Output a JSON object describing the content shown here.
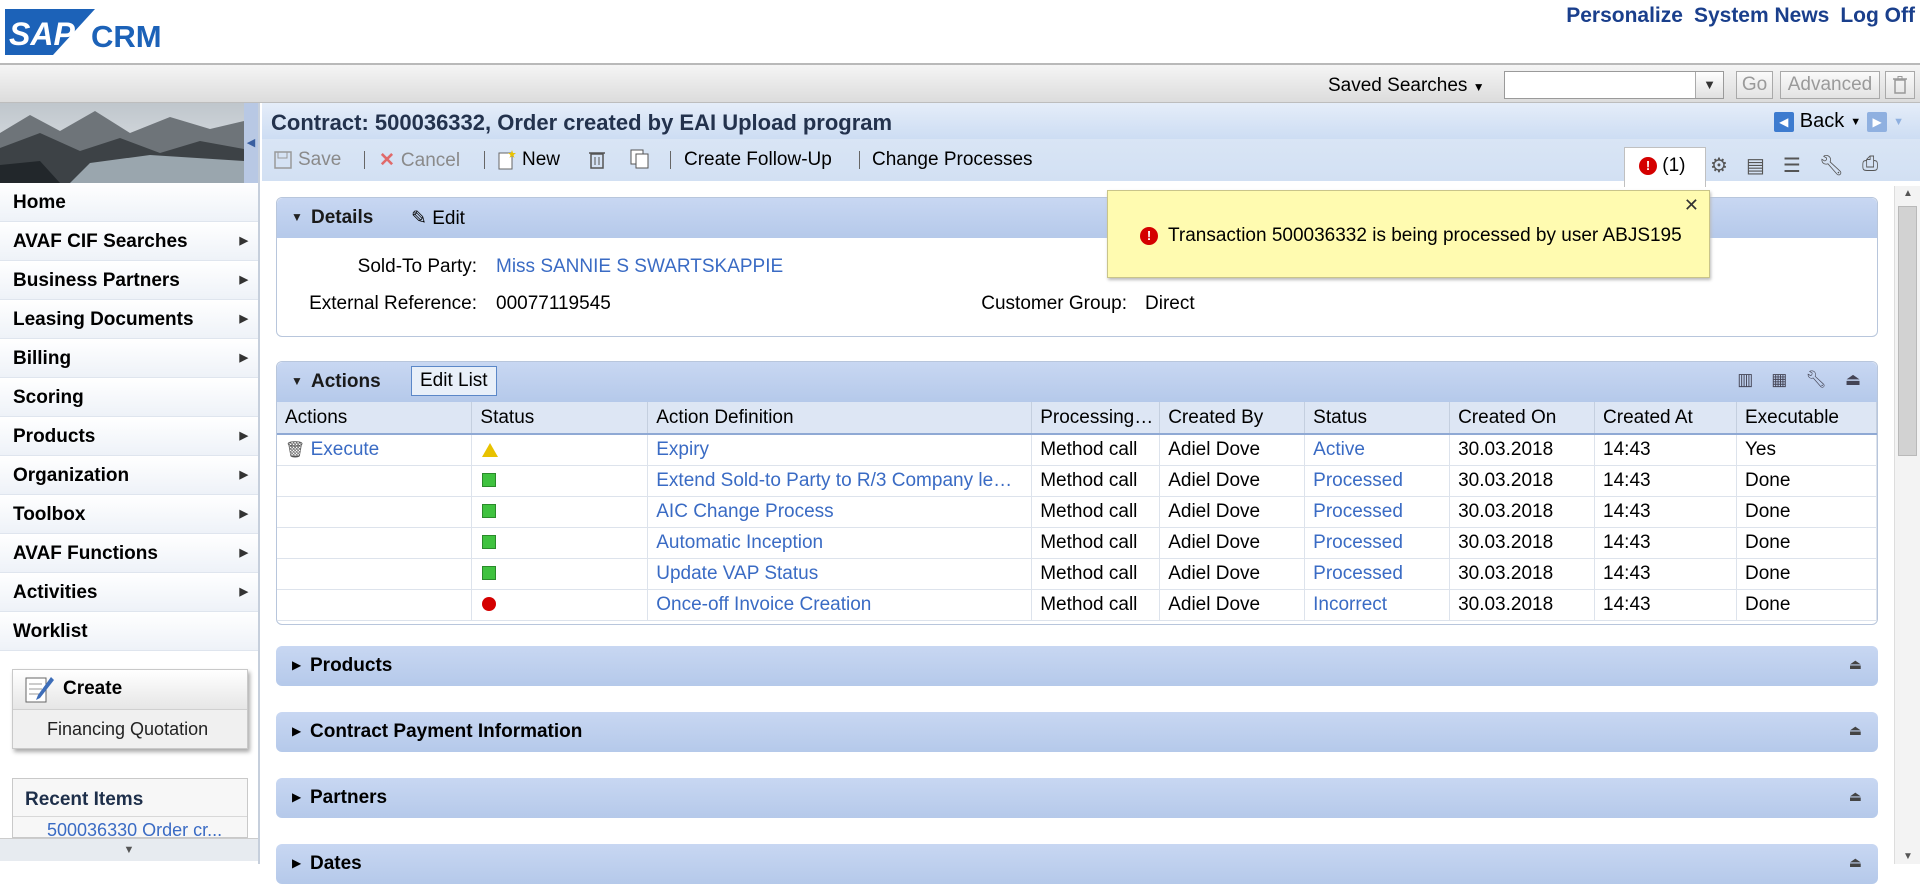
{
  "header": {
    "logo_sap": "SAP",
    "logo_crm": "CRM",
    "links": [
      "Personalize",
      "System News",
      "Log Off"
    ]
  },
  "search": {
    "saved_label": "Saved Searches",
    "go": "Go",
    "advanced": "Advanced"
  },
  "sidebar": {
    "items": [
      {
        "label": "Home",
        "arrow": false
      },
      {
        "label": "AVAF CIF Searches",
        "arrow": true
      },
      {
        "label": "Business Partners",
        "arrow": true
      },
      {
        "label": "Leasing Documents",
        "arrow": true
      },
      {
        "label": "Billing",
        "arrow": true
      },
      {
        "label": "Scoring",
        "arrow": false
      },
      {
        "label": "Products",
        "arrow": true
      },
      {
        "label": "Organization",
        "arrow": true
      },
      {
        "label": "Toolbox",
        "arrow": true
      },
      {
        "label": "AVAF Functions",
        "arrow": true
      },
      {
        "label": "Activities",
        "arrow": true
      },
      {
        "label": "Worklist",
        "arrow": false
      }
    ],
    "create": {
      "title": "Create",
      "item": "Financing Quotation"
    },
    "recent": {
      "title": "Recent Items",
      "item": "500036330 Order cr..."
    }
  },
  "page": {
    "title": "Contract: 500036332, Order created by EAI Upload program",
    "back": "Back",
    "toolbar": {
      "save": "Save",
      "cancel": "Cancel",
      "new": "New",
      "follow_up": "Create Follow-Up",
      "change": "Change Processes"
    },
    "errors": "(1)"
  },
  "details": {
    "title": "Details",
    "edit": "Edit",
    "sold_to_label": "Sold-To Party:",
    "sold_to_value": "Miss SANNIE S SWARTSKAPPIE",
    "ext_ref_label": "External Reference:",
    "ext_ref_value": "00077119545",
    "cust_group_label": "Customer Group:",
    "cust_group_value": "Direct"
  },
  "actions": {
    "title": "Actions",
    "edit_list": "Edit List",
    "columns": [
      "Actions",
      "Status",
      "Action Definition",
      "Processing…",
      "Created By",
      "Status",
      "Created On",
      "Created At",
      "Executable"
    ],
    "execute": "Execute",
    "rows": [
      {
        "status": "yellow",
        "definition": "Expiry",
        "processing": "Method call",
        "by": "Adiel Dove",
        "status_text": "Active",
        "on": "30.03.2018",
        "at": "14:43",
        "exec": "Yes"
      },
      {
        "status": "green",
        "definition": "Extend Sold-to Party to R/3 Company le…",
        "processing": "Method call",
        "by": "Adiel Dove",
        "status_text": "Processed",
        "on": "30.03.2018",
        "at": "14:43",
        "exec": "Done"
      },
      {
        "status": "green",
        "definition": "AIC Change Process",
        "processing": "Method call",
        "by": "Adiel Dove",
        "status_text": "Processed",
        "on": "30.03.2018",
        "at": "14:43",
        "exec": "Done"
      },
      {
        "status": "green",
        "definition": "Automatic Inception",
        "processing": "Method call",
        "by": "Adiel Dove",
        "status_text": "Processed",
        "on": "30.03.2018",
        "at": "14:43",
        "exec": "Done"
      },
      {
        "status": "green",
        "definition": "Update VAP Status",
        "processing": "Method call",
        "by": "Adiel Dove",
        "status_text": "Processed",
        "on": "30.03.2018",
        "at": "14:43",
        "exec": "Done"
      },
      {
        "status": "red",
        "definition": "Once-off Invoice Creation",
        "processing": "Method call",
        "by": "Adiel Dove",
        "status_text": "Incorrect",
        "on": "30.03.2018",
        "at": "14:43",
        "exec": "Done"
      }
    ]
  },
  "collapsed_panels": [
    "Products",
    "Contract Payment Information",
    "Partners",
    "Dates"
  ],
  "popup": {
    "message": "Transaction 500036332 is being processed by user ABJS195"
  }
}
